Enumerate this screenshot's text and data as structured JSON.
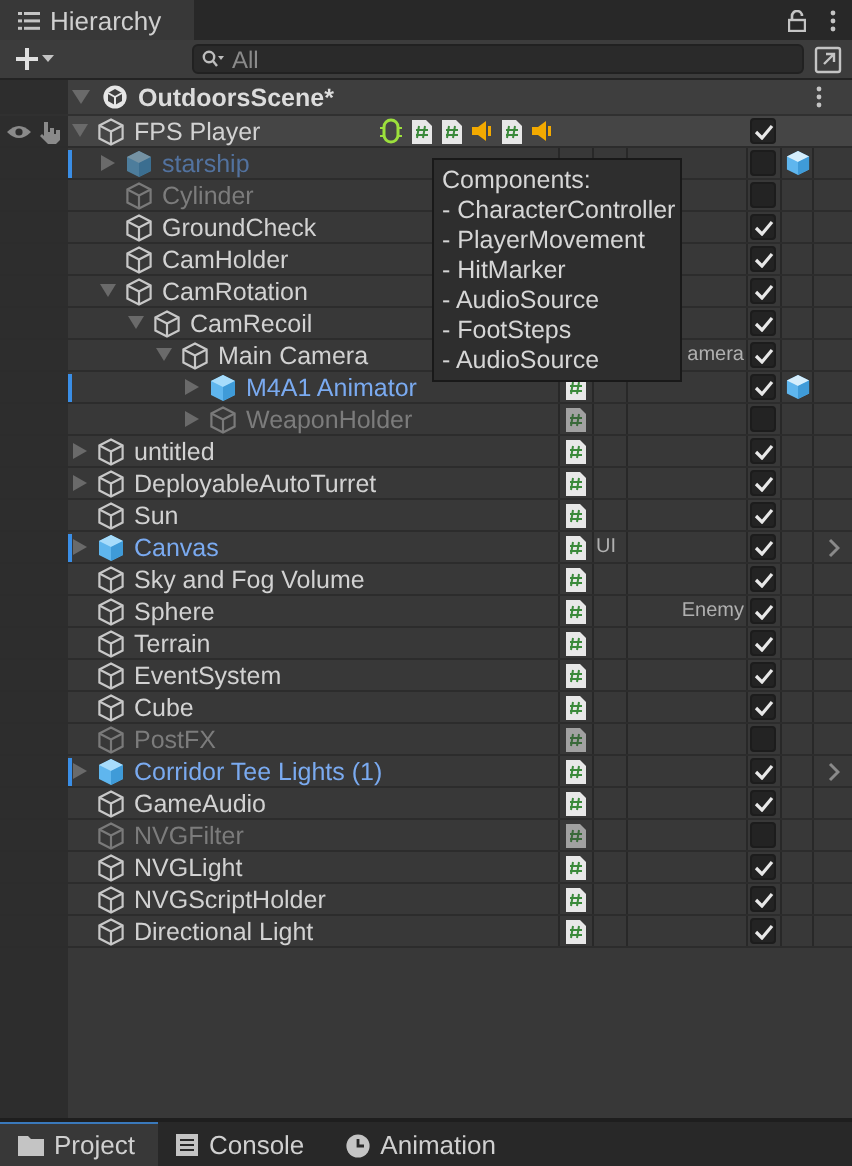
{
  "panel_tab": {
    "title": "Hierarchy"
  },
  "toolbar": {
    "search": {
      "placeholder": "All"
    }
  },
  "scene": {
    "name": "OutdoorsScene*",
    "expanded": true,
    "children": [
      {
        "name": "FPS Player",
        "kind": "object",
        "active": true,
        "checked": true,
        "expanded": true,
        "hovered": true,
        "components": [
          {
            "kind": "controller"
          },
          {
            "kind": "script"
          },
          {
            "kind": "script"
          },
          {
            "kind": "audio"
          },
          {
            "kind": "script"
          },
          {
            "kind": "audio"
          }
        ],
        "children": [
          {
            "name": "starship",
            "kind": "prefab",
            "active": false,
            "checked": false,
            "expanded": false,
            "prefab_link": true
          },
          {
            "name": "Cylinder",
            "kind": "object",
            "active": false,
            "checked": false
          },
          {
            "name": "GroundCheck",
            "kind": "object",
            "active": true,
            "checked": true
          },
          {
            "name": "CamHolder",
            "kind": "object",
            "active": true,
            "checked": true
          },
          {
            "name": "CamRotation",
            "kind": "object",
            "active": true,
            "checked": true,
            "expanded": true,
            "children": [
              {
                "name": "CamRecoil",
                "kind": "object",
                "active": true,
                "checked": true,
                "expanded": true,
                "children": [
                  {
                    "name": "Main Camera",
                    "kind": "object",
                    "active": true,
                    "checked": true,
                    "expanded": true,
                    "column_3": "amera",
                    "children": [
                      {
                        "name": "M4A1 Animator",
                        "kind": "prefab",
                        "active": true,
                        "checked": true,
                        "expanded": false,
                        "script": true,
                        "prefab_link": true
                      },
                      {
                        "name": "WeaponHolder",
                        "kind": "object",
                        "active": false,
                        "checked": false,
                        "expanded": false,
                        "script": true
                      }
                    ]
                  }
                ]
              }
            ]
          }
        ]
      },
      {
        "name": "untitled",
        "kind": "object",
        "active": true,
        "checked": true,
        "expanded": false,
        "script": true
      },
      {
        "name": "DeployableAutoTurret",
        "kind": "object",
        "active": true,
        "checked": true,
        "expanded": false,
        "script": true
      },
      {
        "name": "Sun",
        "kind": "object",
        "active": true,
        "checked": true,
        "script": true
      },
      {
        "name": "Canvas",
        "kind": "prefab",
        "active": true,
        "checked": true,
        "expanded": false,
        "script": true,
        "column_2": "UI",
        "open_arrow": true
      },
      {
        "name": "Sky and Fog Volume",
        "kind": "object",
        "active": true,
        "checked": true,
        "script": true
      },
      {
        "name": "Sphere",
        "kind": "object",
        "active": true,
        "checked": true,
        "script": true,
        "column_3": "Enemy"
      },
      {
        "name": "Terrain",
        "kind": "object",
        "active": true,
        "checked": true,
        "script": true
      },
      {
        "name": "EventSystem",
        "kind": "object",
        "active": true,
        "checked": true,
        "script": true
      },
      {
        "name": "Cube",
        "kind": "object",
        "active": true,
        "checked": true,
        "script": true
      },
      {
        "name": "PostFX",
        "kind": "object",
        "active": false,
        "checked": false,
        "script": true
      },
      {
        "name": "Corridor Tee Lights (1)",
        "kind": "prefab",
        "active": true,
        "checked": true,
        "expanded": false,
        "script": true,
        "open_arrow": true
      },
      {
        "name": "GameAudio",
        "kind": "object",
        "active": true,
        "checked": true,
        "script": true
      },
      {
        "name": "NVGFilter",
        "kind": "object",
        "active": false,
        "checked": false,
        "script": true
      },
      {
        "name": "NVGLight",
        "kind": "object",
        "active": true,
        "checked": true,
        "script": true
      },
      {
        "name": "NVGScriptHolder",
        "kind": "object",
        "active": true,
        "checked": true,
        "script": true
      },
      {
        "name": "Directional Light",
        "kind": "object",
        "active": true,
        "checked": true,
        "script": true
      }
    ]
  },
  "tooltip": {
    "title": "Components:",
    "lines": [
      "- CharacterController",
      "- PlayerMovement",
      "- HitMarker",
      "- AudioSource",
      "- FootSteps",
      "- AudioSource"
    ]
  },
  "bottom_tabs": [
    {
      "label": "Project",
      "selected": true
    },
    {
      "label": "Console",
      "selected": false
    },
    {
      "label": "Animation",
      "selected": false
    }
  ]
}
